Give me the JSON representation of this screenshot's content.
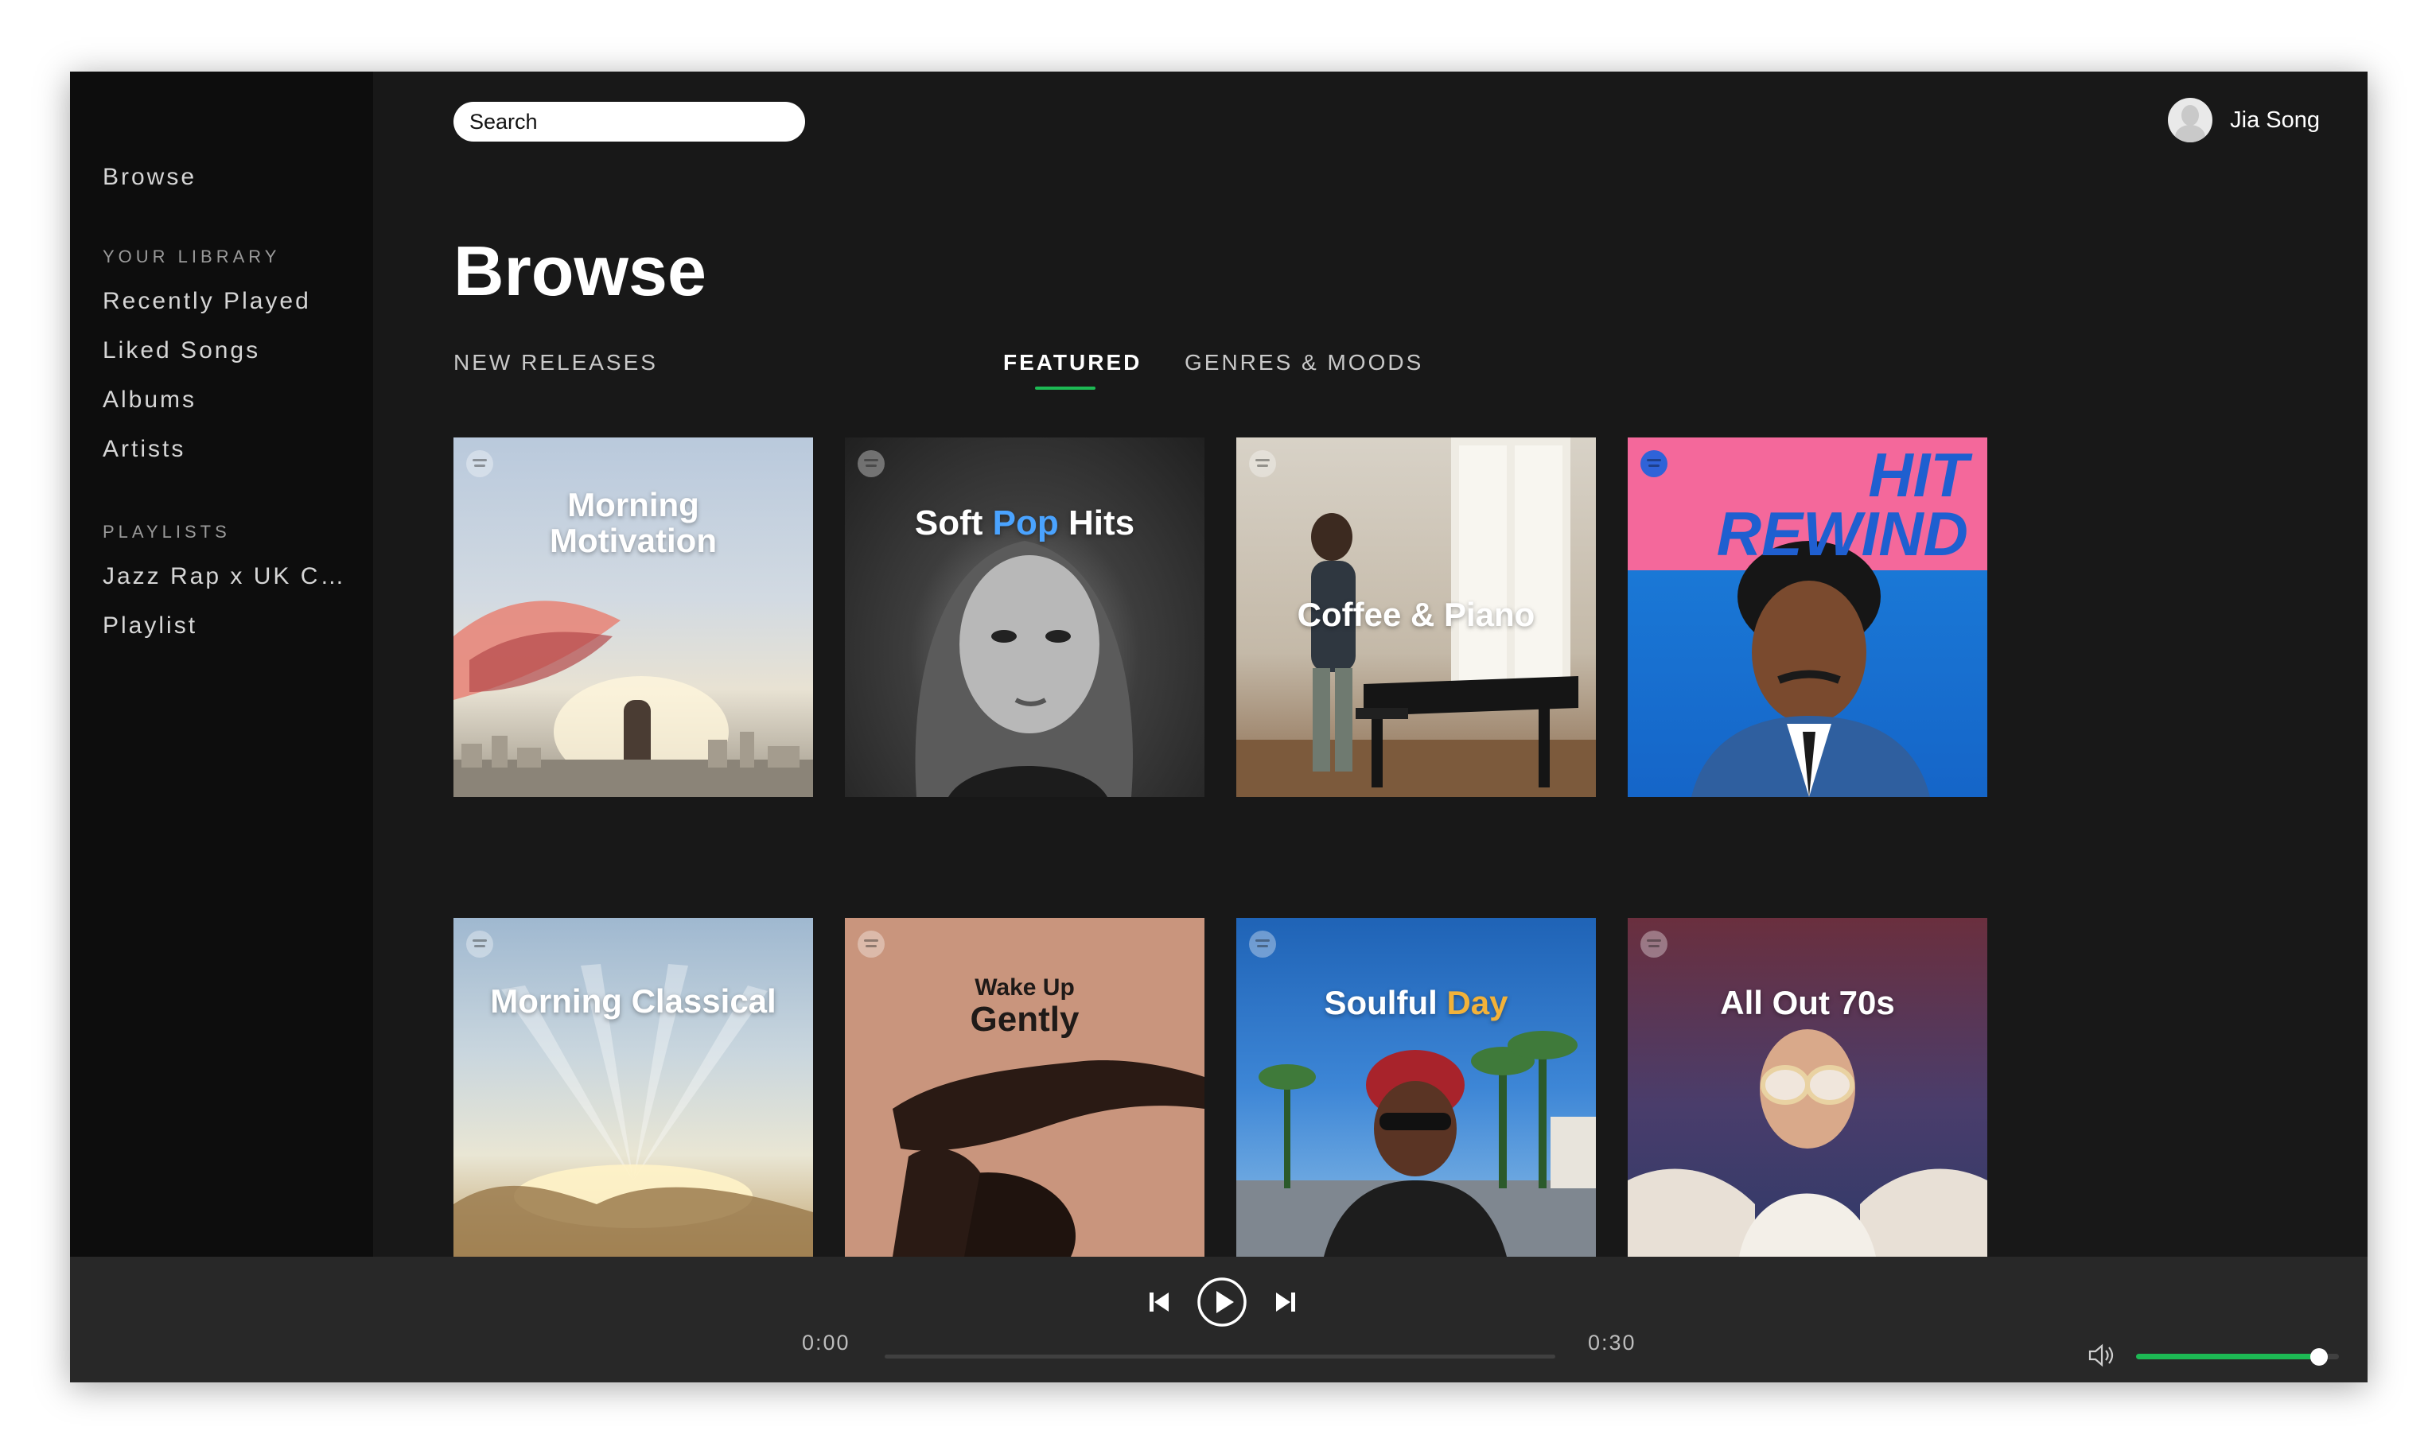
{
  "sidebar": {
    "browse_label": "Browse",
    "library_header": "YOUR LIBRARY",
    "library_items": [
      "Recently Played",
      "Liked Songs",
      "Albums",
      "Artists"
    ],
    "playlists_header": "PLAYLISTS",
    "playlists": [
      "Jazz Rap x UK Chill Hop",
      "Playlist"
    ]
  },
  "search": {
    "placeholder": "Search"
  },
  "user": {
    "name": "Jia Song"
  },
  "page": {
    "title": "Browse"
  },
  "tabs": [
    {
      "label": "NEW RELEASES"
    },
    {
      "label": "FEATURED",
      "active": true
    },
    {
      "label": "GENRES & MOODS"
    }
  ],
  "cards": [
    {
      "title_line1": "Morning",
      "title_line2": "Motivation"
    },
    {
      "title_a": "Soft ",
      "title_b": "Pop",
      "title_c": " Hits"
    },
    {
      "title": "Coffee & Piano"
    },
    {
      "title_line1": "HIT",
      "title_line2": "REWIND"
    },
    {
      "title": "Morning Classical"
    },
    {
      "title_line1": "Wake Up",
      "title_line2": "Gently"
    },
    {
      "title_a": "Soulful ",
      "title_b": "Day"
    },
    {
      "title": "All Out 70s"
    }
  ],
  "player": {
    "elapsed": "0:00",
    "duration": "0:30",
    "progress": 0,
    "volume": 0.9
  },
  "colors": {
    "accent": "#1db954",
    "background": "#181818",
    "sidebar": "#0d0d0d",
    "player": "#282828"
  }
}
